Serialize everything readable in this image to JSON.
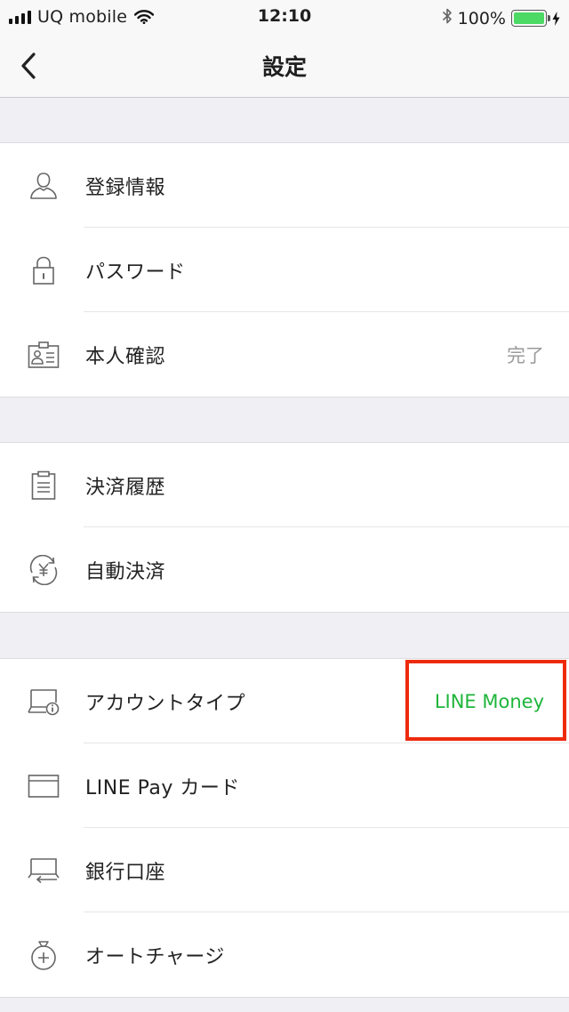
{
  "status_bar": {
    "carrier": "UQ mobile",
    "time": "12:10",
    "battery_percent": "100%",
    "battery_level": 1.0,
    "icons": [
      "signal-icon",
      "wifi-icon",
      "bluetooth-icon",
      "battery-icon",
      "charging-icon"
    ]
  },
  "nav": {
    "title": "設定",
    "back_icon": "chevron-left-icon"
  },
  "sections": [
    {
      "items": [
        {
          "label": "登録情報",
          "icon": "person-icon",
          "value": ""
        },
        {
          "label": "パスワード",
          "icon": "lock-icon",
          "value": ""
        },
        {
          "label": "本人確認",
          "icon": "id-card-icon",
          "value": "完了"
        }
      ]
    },
    {
      "items": [
        {
          "label": "決済履歴",
          "icon": "clipboard-icon",
          "value": ""
        },
        {
          "label": "自動決済",
          "icon": "yen-cycle-icon",
          "value": ""
        }
      ]
    },
    {
      "items": [
        {
          "label": "アカウントタイプ",
          "icon": "account-info-icon",
          "value": "LINE Money"
        },
        {
          "label": "LINE Pay カード",
          "icon": "card-icon",
          "value": ""
        },
        {
          "label": "銀行口座",
          "icon": "bank-transfer-icon",
          "value": ""
        },
        {
          "label": "オートチャージ",
          "icon": "moneybag-plus-icon",
          "value": ""
        }
      ]
    }
  ],
  "colors": {
    "accent_green": "#1eb53a",
    "highlight_red": "#ee2a0c",
    "background": "#efeff4"
  }
}
